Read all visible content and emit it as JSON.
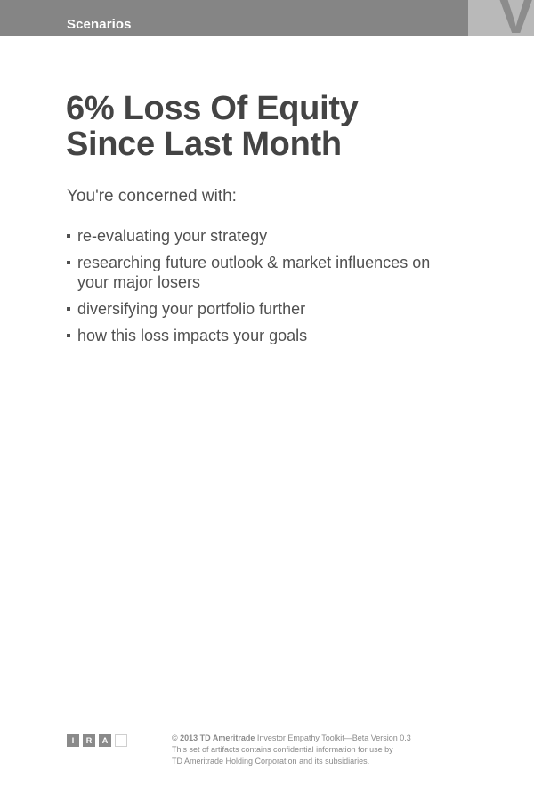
{
  "header": {
    "title": "Scenarios",
    "tab_letter": "V"
  },
  "main": {
    "title_line1": "6% Loss Of Equity",
    "title_line2": "Since Last Month",
    "intro": "You're concerned with:",
    "concerns": [
      "re-evaluating your strategy",
      "researching future outlook & market influences on your major losers",
      "diversifying your portfolio further",
      "how this loss impacts your goals"
    ]
  },
  "footer": {
    "logo_letters": [
      "I",
      "R",
      "A",
      ""
    ],
    "copyright": "© 2013 TD Ameritrade",
    "product": " Investor Empathy Toolkit—Beta Version 0.3",
    "line2": "This set of artifacts contains confidential information for use by",
    "line3": "TD Ameritrade Holding Corporation and its subsidiaries."
  },
  "colors": {
    "header_bar": "#858585",
    "header_tab": "#b9b9b9",
    "text": "#444444"
  }
}
